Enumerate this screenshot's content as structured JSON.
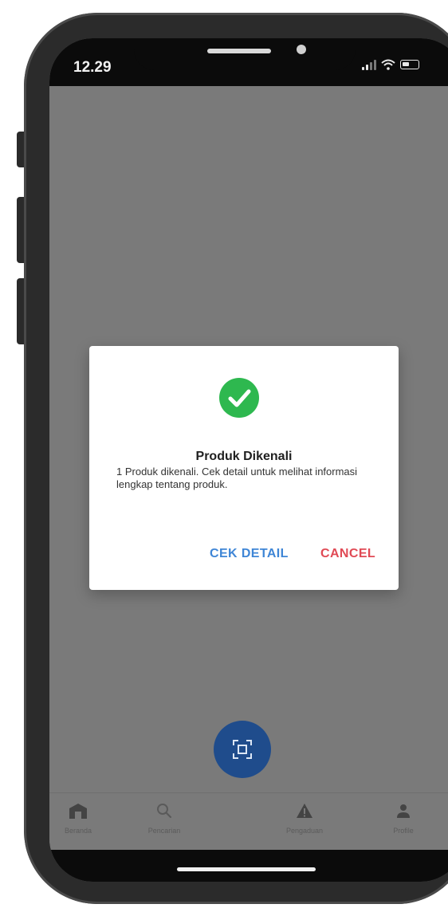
{
  "status_bar": {
    "time": "12.29"
  },
  "dialog": {
    "icon": "check-circle-icon",
    "title": "Produk Dikenali",
    "message": "1 Produk dikenali. Cek detail untuk melihat informasi lengkap tentang produk.",
    "primary_button": "CEK DETAIL",
    "secondary_button": "CANCEL"
  },
  "bottom_nav": {
    "items": [
      {
        "label": "Beranda",
        "icon": "home-icon"
      },
      {
        "label": "Pencarian",
        "icon": "search-icon"
      },
      {
        "label": "Pengaduan",
        "icon": "warning-icon"
      },
      {
        "label": "Profile",
        "icon": "user-icon"
      }
    ],
    "scan_button_icon": "scan-icon"
  },
  "colors": {
    "success": "#2eb84f",
    "primary_button": "#3f86d6",
    "cancel_button": "#e04a55",
    "scan_fab": "#1f4c8c",
    "overlay": "#7a7a7a"
  }
}
